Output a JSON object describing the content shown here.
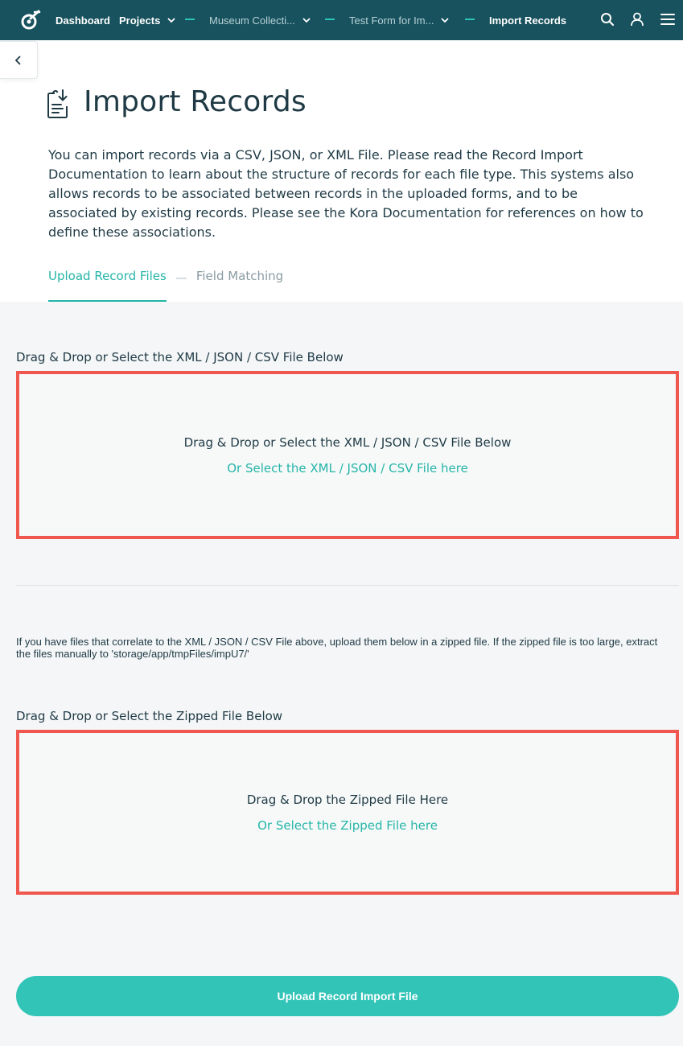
{
  "nav": {
    "logo": "kora-logo-icon",
    "dashboard": "Dashboard",
    "projects": "Projects",
    "project": "Museum Collecti...",
    "form": "Test Form for Im...",
    "current": "Import Records",
    "accent": "#2bc4b6",
    "background": "#17525e"
  },
  "header": {
    "title": "Import Records",
    "description": "You can import records via a CSV, JSON, or XML File. Please read the Record Import Documentation to learn about the structure of records for each file type. This systems also allows records to be associated between records in the uploaded forms, and to be associated by existing records. Please see the Kora Documentation for references on how to define these associations."
  },
  "tabs": [
    {
      "label": "Upload Record Files",
      "active": true
    },
    {
      "label": "Field Matching",
      "active": false
    }
  ],
  "record_file": {
    "label": "Drag & Drop or Select the XML / JSON / CSV File Below",
    "dropzone_text": "Drag & Drop or Select the XML / JSON / CSV File Below",
    "select_link": "Or Select the XML / JSON / CSV File here"
  },
  "zip_note": "If you have files that correlate to the XML / JSON / CSV File above, upload them below in a zipped file. If the zipped file is too large, extract the files manually to 'storage/app/tmpFiles/impU7/'",
  "zip_file": {
    "label": "Drag & Drop or Select the Zipped File Below",
    "dropzone_text": "Drag & Drop the Zipped File Here",
    "select_link": "Or Select the Zipped File here"
  },
  "actions": {
    "upload": "Upload Record Import File"
  },
  "colors": {
    "teal": "#26b5a8",
    "dropzone_border": "#f0584f"
  }
}
